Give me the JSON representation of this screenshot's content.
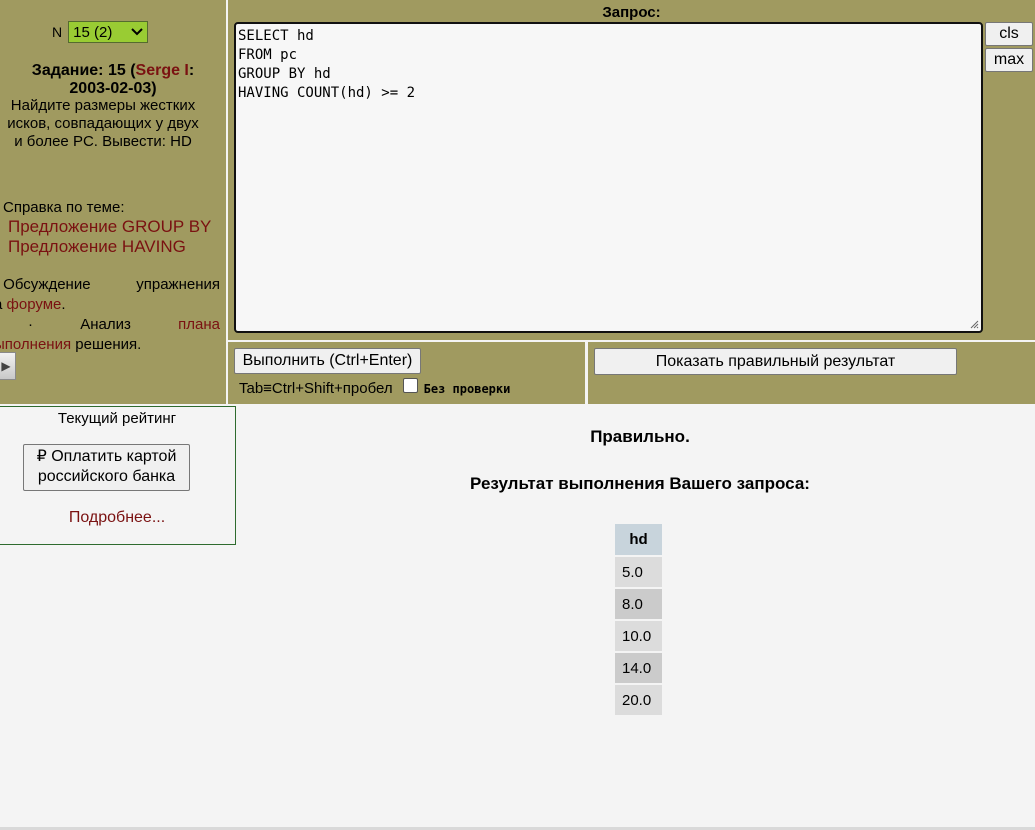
{
  "task_selector": {
    "label": "N",
    "value": "15 (2)"
  },
  "task": {
    "prefix": "Задание: 15 (",
    "author": "Serge I",
    "suffix": ":",
    "date": "2003-02-03)",
    "lines": [
      "Найдите размеры жестких",
      "исков, совпадающих у двух",
      "и более PC. Вывести: HD"
    ]
  },
  "help": {
    "title": "Справка по теме:",
    "links": [
      "Предложение GROUP BY",
      "Предложение HAVING"
    ]
  },
  "forum": {
    "line1_a": "· Обсуждение",
    "line1_b": "упражнения",
    "line2_a": "а ",
    "line2_link": "форуме",
    "line2_b": ".",
    "line3_a": "·",
    "line3_b": "Анализ",
    "line3_link": "плана",
    "line4_link": "ыполнения",
    "line4_b": " решения."
  },
  "query": {
    "label": "Запрос:",
    "text": "SELECT hd\nFROM pc\nGROUP BY hd\nHAVING COUNT(hd) >= 2",
    "cls_label": "cls",
    "max_label": "max"
  },
  "execute": {
    "button_label": "Выполнить (Ctrl+Enter)",
    "hint": "Tab≡Ctrl+Shift+пробел",
    "nocheck_label": "Без проверки"
  },
  "show_result_label": "Показать правильный результат",
  "rating": {
    "title": "Текущий рейтинг",
    "pay_line1": "₽ Оплатить картой",
    "pay_line2": "российского банка",
    "more": "Подробнее..."
  },
  "result": {
    "status": "Правильно.",
    "title": "Результат выполнения Вашего запроса:",
    "column": "hd",
    "rows": [
      "5.0",
      "8.0",
      "10.0",
      "14.0",
      "20.0"
    ]
  }
}
